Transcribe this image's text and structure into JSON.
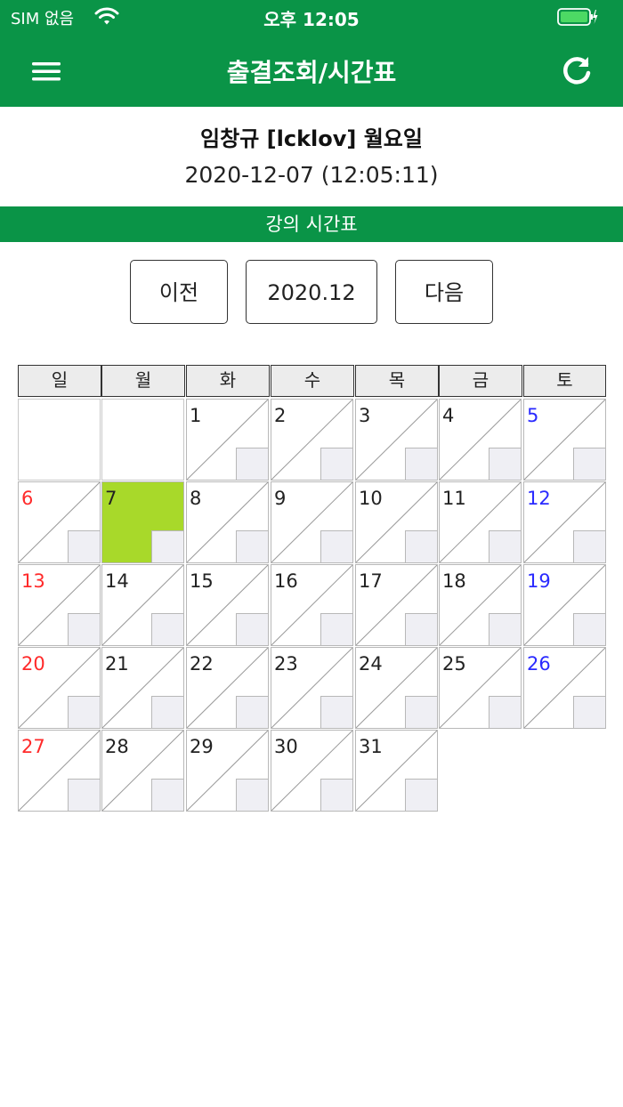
{
  "status": {
    "carrier": "SIM 없음",
    "time": "오후 12:05"
  },
  "nav": {
    "title": "출결조회/시간표"
  },
  "user": {
    "line": "임창규 [lcklov] 월요일",
    "datetime": "2020-12-07 (12:05:11)"
  },
  "section": {
    "title": "강의 시간표"
  },
  "controls": {
    "prev_label": "이전",
    "month_label": "2020.12",
    "next_label": "다음"
  },
  "calendar": {
    "weekdays": [
      "일",
      "월",
      "화",
      "수",
      "목",
      "금",
      "토"
    ],
    "days": [
      "1",
      "2",
      "3",
      "4",
      "5",
      "6",
      "7",
      "8",
      "9",
      "10",
      "11",
      "12",
      "13",
      "14",
      "15",
      "16",
      "17",
      "18",
      "19",
      "20",
      "21",
      "22",
      "23",
      "24",
      "25",
      "26",
      "27",
      "28",
      "29",
      "30",
      "31"
    ],
    "today": "7",
    "colors": {
      "header_green": "#0a9447",
      "today_fill": "#a8d92a",
      "sunday": "#ff2a2a",
      "saturday": "#2a2aff"
    }
  }
}
